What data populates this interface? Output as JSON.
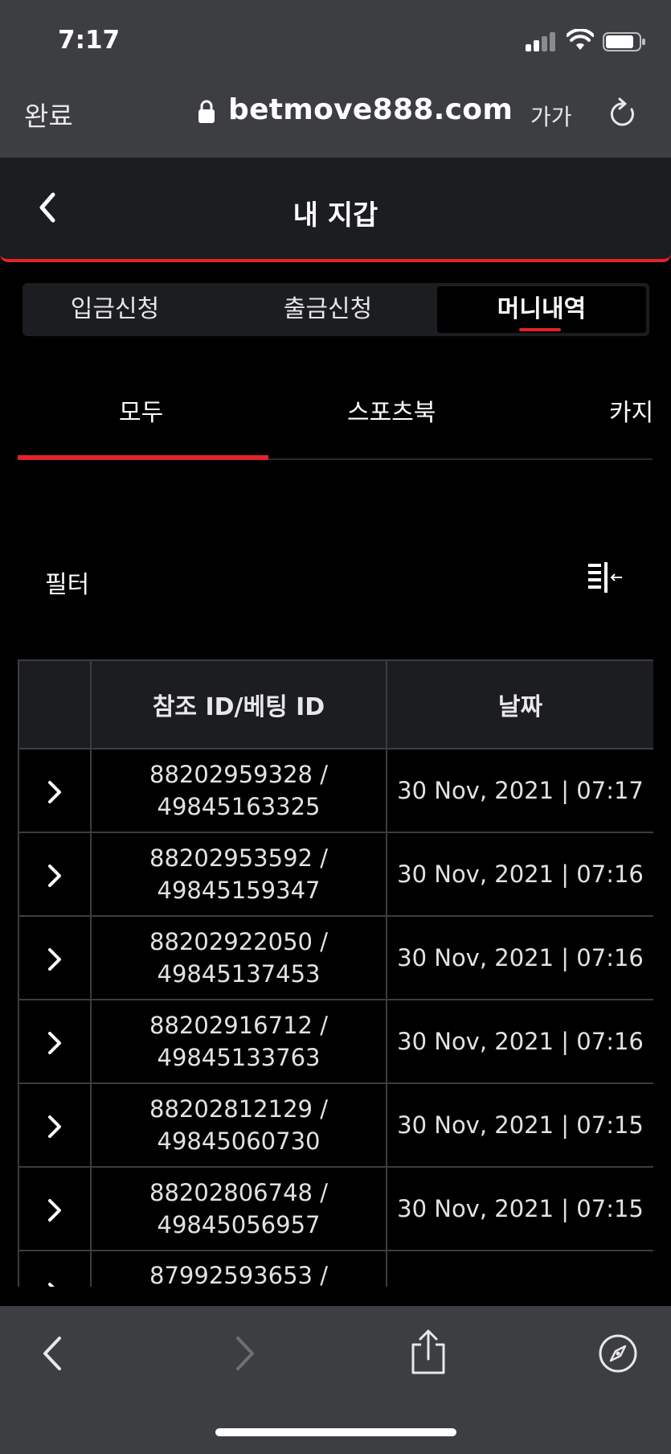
{
  "status": {
    "time": "7:17"
  },
  "urlbar": {
    "done_label": "완료",
    "domain": "betmove888.com",
    "text_size_label": "가가"
  },
  "header": {
    "title": "내 지갑"
  },
  "wallet_tabs": [
    {
      "label": "입금신청"
    },
    {
      "label": "출금신청"
    },
    {
      "label": "머니내역",
      "active": true
    }
  ],
  "sub_tabs": [
    {
      "label": "모두",
      "active": true
    },
    {
      "label": "스포츠북"
    },
    {
      "label": "카지"
    }
  ],
  "filter": {
    "label": "필터"
  },
  "table": {
    "headers": [
      "",
      "참조 ID/베팅 ID",
      "날짜"
    ],
    "rows": [
      {
        "ref_id": "88202959328 /",
        "bet_id": "49845163325",
        "date": "30 Nov, 2021 | 07:17"
      },
      {
        "ref_id": "88202953592 /",
        "bet_id": "49845159347",
        "date": "30 Nov, 2021 | 07:16"
      },
      {
        "ref_id": "88202922050 /",
        "bet_id": "49845137453",
        "date": "30 Nov, 2021 | 07:16"
      },
      {
        "ref_id": "88202916712 /",
        "bet_id": "49845133763",
        "date": "30 Nov, 2021 | 07:16"
      },
      {
        "ref_id": "88202812129 /",
        "bet_id": "49845060730",
        "date": "30 Nov, 2021 | 07:15"
      },
      {
        "ref_id": "88202806748 /",
        "bet_id": "49845056957",
        "date": "30 Nov, 2021 | 07:15"
      },
      {
        "ref_id": "87992593653 /",
        "bet_id": "",
        "date": ""
      }
    ]
  },
  "colors": {
    "accent": "#e2232a",
    "chrome": "#3d3e42",
    "panel": "#1c1d21"
  },
  "icons": {
    "signal": "cellular-signal-icon",
    "wifi": "wifi-icon",
    "battery": "battery-icon",
    "lock": "lock-icon",
    "reload": "reload-icon",
    "back": "chevron-left-icon",
    "filter": "filter-columns-icon",
    "row_expand": "chevron-right-icon",
    "share": "share-icon",
    "compass": "compass-icon"
  }
}
